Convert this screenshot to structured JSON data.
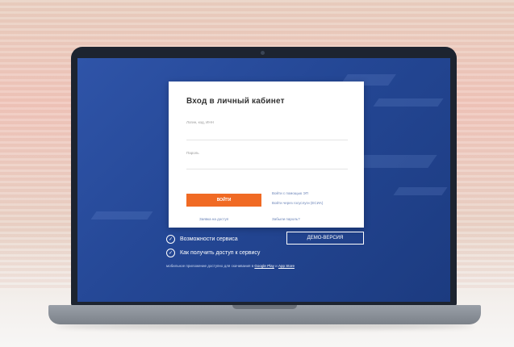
{
  "login": {
    "title": "Вход в личный кабинет",
    "login_label": "Логин, код, ИНН",
    "password_label": "Пароль",
    "login_button": "ВОЙТИ",
    "alt_login_1": "Войти с помощью ЭП",
    "alt_login_2": "Войти через госуслуги (ЕСИА)",
    "register_link": "Заявка на доступ",
    "forgot_link": "Забыли пароль?"
  },
  "features": {
    "capabilities": "Возможности сервиса",
    "how_to_access": "Как получить доступ к сервису"
  },
  "demo_button": "ДЕМО-ВЕРСИЯ",
  "apps": {
    "text": "мобильное приложение доступно для скачивания в",
    "google_play": "Google Play",
    "and": "и",
    "app_store": "App Store"
  },
  "colors": {
    "accent": "#f06a24",
    "screen_bg": "#244795"
  },
  "icons": {
    "check": "check-circle-icon"
  }
}
